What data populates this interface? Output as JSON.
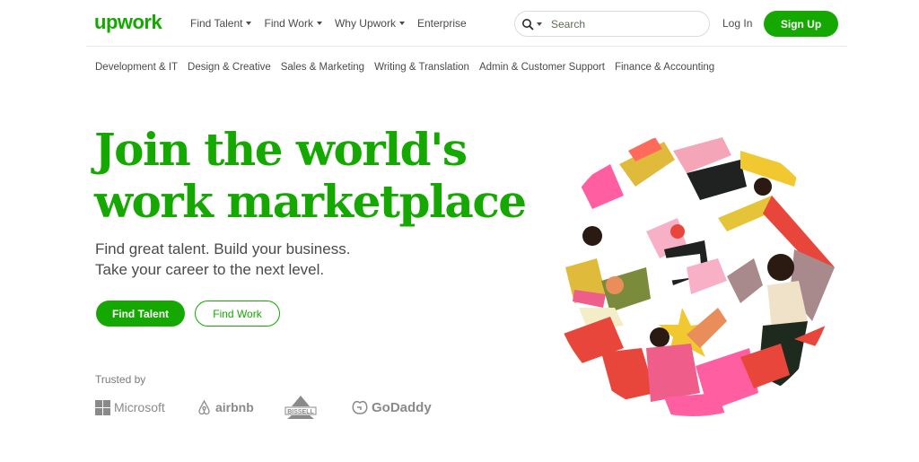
{
  "brand": {
    "logo_text": "upwork",
    "accent": "#14a800"
  },
  "nav": {
    "items": [
      {
        "label": "Find Talent",
        "has_dropdown": true
      },
      {
        "label": "Find Work",
        "has_dropdown": true
      },
      {
        "label": "Why Upwork",
        "has_dropdown": true
      },
      {
        "label": "Enterprise",
        "has_dropdown": false
      }
    ]
  },
  "search": {
    "placeholder": "Search",
    "icon": "search-icon"
  },
  "auth": {
    "login_label": "Log In",
    "signup_label": "Sign Up"
  },
  "categories": [
    "Development & IT",
    "Design & Creative",
    "Sales & Marketing",
    "Writing & Translation",
    "Admin & Customer Support",
    "Finance & Accounting"
  ],
  "hero": {
    "title_line1": "Join the world's",
    "title_line2": "work marketplace",
    "subtitle_line1": "Find great talent. Build your business.",
    "subtitle_line2": "Take your career to the next level.",
    "primary_cta": "Find Talent",
    "secondary_cta": "Find Work"
  },
  "trusted": {
    "label": "Trusted by",
    "logos": [
      "Microsoft",
      "airbnb",
      "BISSELL",
      "GoDaddy"
    ]
  }
}
